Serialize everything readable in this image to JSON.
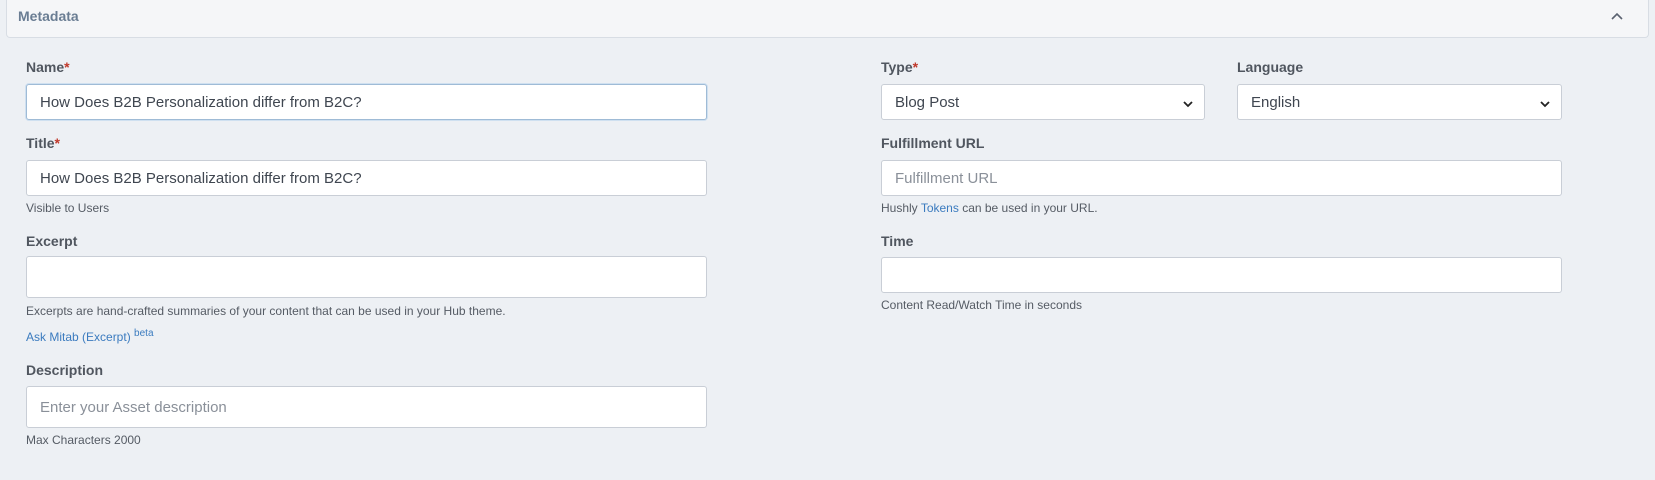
{
  "panel": {
    "title": "Metadata",
    "collapse_icon": "chevron-up-icon"
  },
  "fields": {
    "name": {
      "label": "Name",
      "required_mark": "*",
      "value": "How Does B2B Personalization differ from B2C?"
    },
    "title": {
      "label": "Title",
      "required_mark": "*",
      "value": "How Does B2B Personalization differ from B2C?",
      "help": "Visible to Users"
    },
    "excerpt": {
      "label": "Excerpt",
      "value": "",
      "help": "Excerpts are hand-crafted summaries of your content that can be used in your Hub theme.",
      "ask_link": "Ask Mitab (Excerpt)",
      "ask_badge": "beta"
    },
    "description": {
      "label": "Description",
      "value": "",
      "placeholder": "Enter your Asset description",
      "help": "Max Characters 2000"
    },
    "type": {
      "label": "Type",
      "required_mark": "*",
      "selected": "Blog Post"
    },
    "language": {
      "label": "Language",
      "selected": "English"
    },
    "fulfillment_url": {
      "label": "Fulfillment URL",
      "value": "",
      "placeholder": "Fulfillment URL",
      "help_prefix": "Hushly",
      "help_link": "Tokens",
      "help_suffix": "can be used in your URL."
    },
    "time": {
      "label": "Time",
      "value": "",
      "help": "Content Read/Watch Time in seconds"
    }
  },
  "colors": {
    "link": "#3b7bbf",
    "required": "#c0392b",
    "background": "#edf0f4"
  }
}
